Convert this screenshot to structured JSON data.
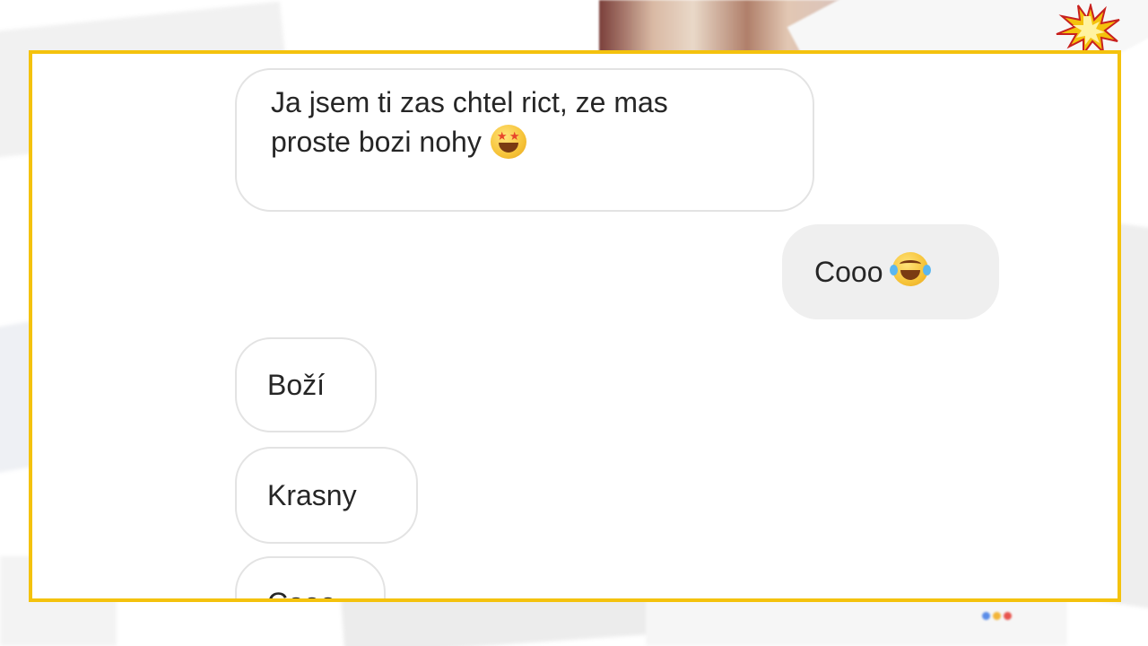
{
  "chat": {
    "messages": [
      {
        "direction": "incoming",
        "lines": [
          "Ja jsem ti zas chtel rict, ze mas",
          "proste bozi nohy"
        ],
        "emoji": "star-struck-emoji"
      },
      {
        "direction": "outgoing",
        "text": "Cooo",
        "emoji": "tears-of-joy-emoji"
      },
      {
        "direction": "incoming",
        "text": "Boží"
      },
      {
        "direction": "incoming",
        "text": "Krasny"
      },
      {
        "direction": "incoming",
        "text": "Cooo"
      }
    ]
  },
  "colors": {
    "frame": "#f4c20d",
    "bubble_border": "#e3e3e3",
    "outgoing_bubble": "#efefef",
    "text": "#262626"
  }
}
